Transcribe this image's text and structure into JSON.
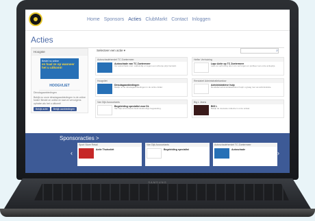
{
  "nav": {
    "items": [
      "Home",
      "Sponsors",
      "Acties",
      "ClubMarkt",
      "Contact",
      "Inloggen"
    ],
    "active": "Acties"
  },
  "page": {
    "title": "Acties"
  },
  "left_panel": {
    "header": "Hoogste",
    "ad_line1": "Bestel nu online",
    "ad_line2": "en haal ze op wanneer het u uitkomt!",
    "brand": "HOOGVLIET",
    "caption_title": "Dinsdagaanbiedingen",
    "caption_text": "Bekijk nu onze dinsdagaanbiedingen in de online folder! Bestel ze online en laat ze vervolgens ophalen als het u uitkomt!",
    "buttons": [
      "Bekijk actie",
      "Bekijk aanbiedingen"
    ]
  },
  "filter": {
    "select_label": "Selecteer een actie"
  },
  "cards": [
    {
      "head": "Autoschadeherstel TC Zoetermeer",
      "title": "Autoschade van TC Zoetermeer",
      "text": "Uw autoschade snel, vakkundig en tegen een scherpe prijs hersteld.",
      "variant": "blue"
    },
    {
      "head": "Hefter Verhuizing",
      "title": "Lapz Actie op TC Zoetermeer",
      "text": "Laat uw verhuizing door ons verzorgen en profiteer van onze actieprijs.",
      "variant": "white"
    },
    {
      "head": "Hoogvliet",
      "title": "Dinsdagaanbiedingen",
      "text": "Bekijk nu de dinsdagaanbiedingen in de online folder.",
      "variant": "blue"
    },
    {
      "head": "Rendabel Administratiekantoor",
      "title": "Administratieve hulp",
      "text": "Rendabel administratiekantoor helpt u graag met uw administratie.",
      "variant": "white"
    },
    {
      "head": "Van Dijk Accountants",
      "title": "Begeleiding specialist voor DL",
      "text": "Van Dijk accountants biedt deskundige begeleiding.",
      "variant": "white"
    },
    {
      "head": "Big L Jeans",
      "title": "BIG L",
      "text": "Bekijk de nieuwste collectie in onze winkel.",
      "variant": "dark"
    }
  ],
  "sponsoracties": {
    "title": "Sponsoracties >",
    "slides": [
      {
        "head": "Sport Store Retail",
        "title": "Actie Thuisshirt",
        "variant": "red"
      },
      {
        "head": "Van Dijk Accountants",
        "title": "Begeleiding specialist",
        "variant": "white"
      },
      {
        "head": "Autoschadeherstel TC Zoetermeer",
        "title": "Autoschade",
        "variant": "blue"
      }
    ]
  },
  "laptop_brand": "SAMSUNG"
}
